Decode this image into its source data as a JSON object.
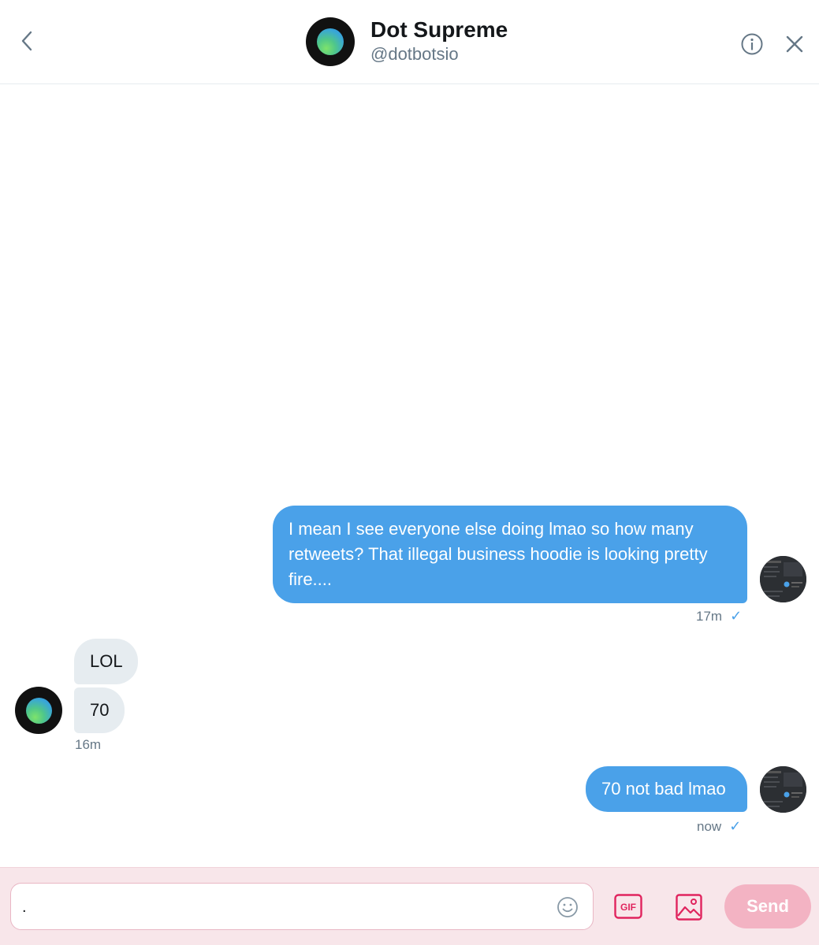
{
  "header": {
    "name": "Dot Supreme",
    "handle": "@dotbotsio"
  },
  "messages": [
    {
      "direction": "outgoing",
      "lines": [
        "I mean I see everyone else doing lmao so how many",
        "retweets? That illegal business hoodie is looking pretty",
        "fire...."
      ],
      "time": "17m",
      "status": "✓"
    },
    {
      "direction": "incoming",
      "text": "LOL"
    },
    {
      "direction": "incoming",
      "text": "70",
      "time": "16m"
    },
    {
      "direction": "outgoing",
      "text": "70 not bad lmao",
      "time": "now",
      "status": "✓"
    }
  ],
  "composer": {
    "input_value": ".",
    "send_label": "Send",
    "gif_label": "GIF"
  },
  "colors": {
    "outgoing_bubble": "#4aa1e9",
    "incoming_bubble": "#e6ecf0",
    "composer_bg": "#f8e6ea",
    "accent_pink": "#e0245e"
  }
}
